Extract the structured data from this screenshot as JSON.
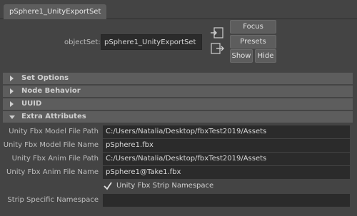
{
  "tab": {
    "title": "pSphere1_UnityExportSet"
  },
  "object_set": {
    "label": "objectSet:",
    "value": "pSphere1_UnityExportSet"
  },
  "buttons": {
    "focus": "Focus",
    "presets": "Presets",
    "show": "Show",
    "hide": "Hide"
  },
  "sections": [
    {
      "label": "Set Options",
      "expanded": false
    },
    {
      "label": "Node Behavior",
      "expanded": false
    },
    {
      "label": "UUID",
      "expanded": false
    },
    {
      "label": "Extra Attributes",
      "expanded": true
    }
  ],
  "extra_attributes": [
    {
      "label": "Unity Fbx Model File Path",
      "value": "C:/Users/Natalia/Desktop/fbxTest2019/Assets"
    },
    {
      "label": "Unity Fbx Model File Name",
      "value": "pSphere1.fbx"
    },
    {
      "label": "Unity Fbx Anim File Path",
      "value": "C:/Users/Natalia/Desktop/fbxTest2019/Assets"
    },
    {
      "label": "Unity Fbx Anim File Name",
      "value": "pSphere1@Take1.fbx"
    }
  ],
  "strip_namespace": {
    "label": "Unity Fbx Strip Namespace",
    "checked": true
  },
  "strip_specific": {
    "label": "Strip Specific Namespace",
    "value": ""
  },
  "colors": {
    "background": "#444444",
    "section_header": "#5d5d5d",
    "field_background": "#2b2b2b",
    "button": "#5d5d5d"
  }
}
